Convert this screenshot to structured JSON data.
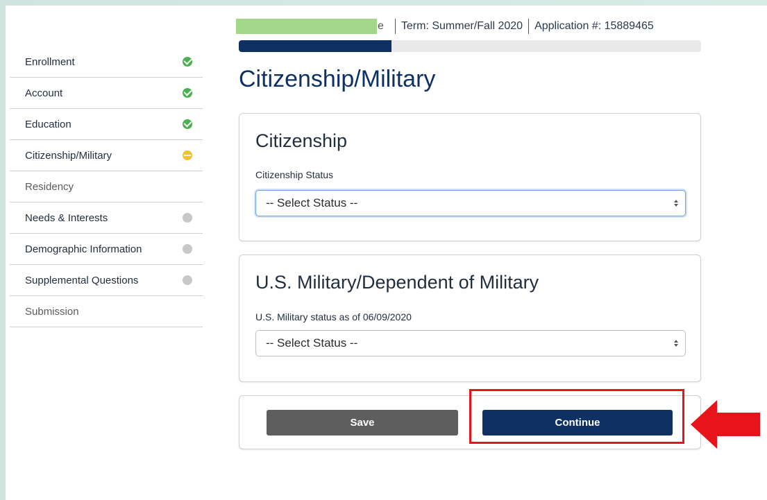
{
  "header": {
    "name_fragment": "e",
    "term": "Term: Summer/Fall 2020",
    "application": "Application #: 15889465"
  },
  "progress": {
    "fraction": 0.33
  },
  "sidebar": {
    "items": [
      {
        "label": "Enrollment",
        "status": "complete"
      },
      {
        "label": "Account",
        "status": "complete"
      },
      {
        "label": "Education",
        "status": "complete"
      },
      {
        "label": "Citizenship/Military",
        "status": "in-progress"
      },
      {
        "label": "Residency",
        "status": "none"
      },
      {
        "label": "Needs & Interests",
        "status": "incomplete"
      },
      {
        "label": "Demographic Information",
        "status": "incomplete"
      },
      {
        "label": "Supplemental Questions",
        "status": "incomplete"
      },
      {
        "label": "Submission",
        "status": "none"
      }
    ]
  },
  "main": {
    "title": "Citizenship/Military",
    "citizenship": {
      "heading": "Citizenship",
      "field_label": "Citizenship Status",
      "select_value": "-- Select Status --"
    },
    "military": {
      "heading": "U.S. Military/Dependent of Military",
      "field_label": "U.S. Military status as of 06/09/2020",
      "select_value": "-- Select Status --"
    },
    "actions": {
      "save_label": "Save",
      "continue_label": "Continue"
    }
  },
  "colors": {
    "brand_navy": "#0f3062",
    "complete_green": "#4caf50",
    "in_progress_yellow": "#f2c230",
    "annotation_red": "#e8141b",
    "redaction_green": "#a3d88b"
  }
}
